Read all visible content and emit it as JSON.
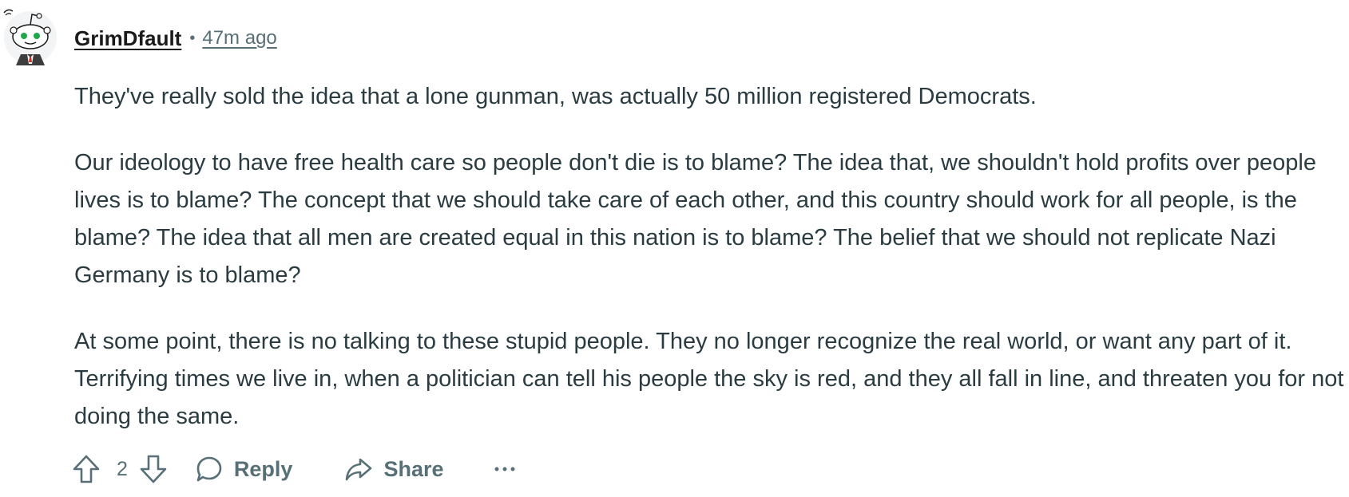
{
  "comment": {
    "author": "GrimDfault",
    "separator": "•",
    "timestamp": "47m ago",
    "paragraphs": [
      "They've really sold the idea that a lone gunman, was actually 50 million registered Democrats.",
      "Our ideology to have free health care so people don't die is to blame? The idea that, we shouldn't hold profits over people lives is to blame? The concept that we should take care of each other, and this country should work for all people, is the blame? The idea that all men are created equal in this nation is to blame? The belief that we should not replicate Nazi Germany is to blame?",
      "At some point, there is no talking to these stupid people. They no longer recognize the real world, or want any part of it. Terrifying times we live in, when a politician can tell his people the sky is red, and they all fall in line, and threaten you for not doing the same."
    ],
    "vote_count": "2"
  },
  "actions": {
    "reply_label": "Reply",
    "share_label": "Share"
  },
  "icons": {
    "avatar": "reddit-snoo-avatar",
    "upvote": "upvote-arrow-icon",
    "downvote": "downvote-arrow-icon",
    "reply": "speech-bubble-icon",
    "share": "share-arrow-icon",
    "more": "ellipsis-icon"
  },
  "colors": {
    "text": "#2a3c42",
    "meta": "#576f76",
    "author": "#1a1a1b",
    "avatar_eyes": "#1fa84a",
    "avatar_bg": "#f2f4f5"
  }
}
